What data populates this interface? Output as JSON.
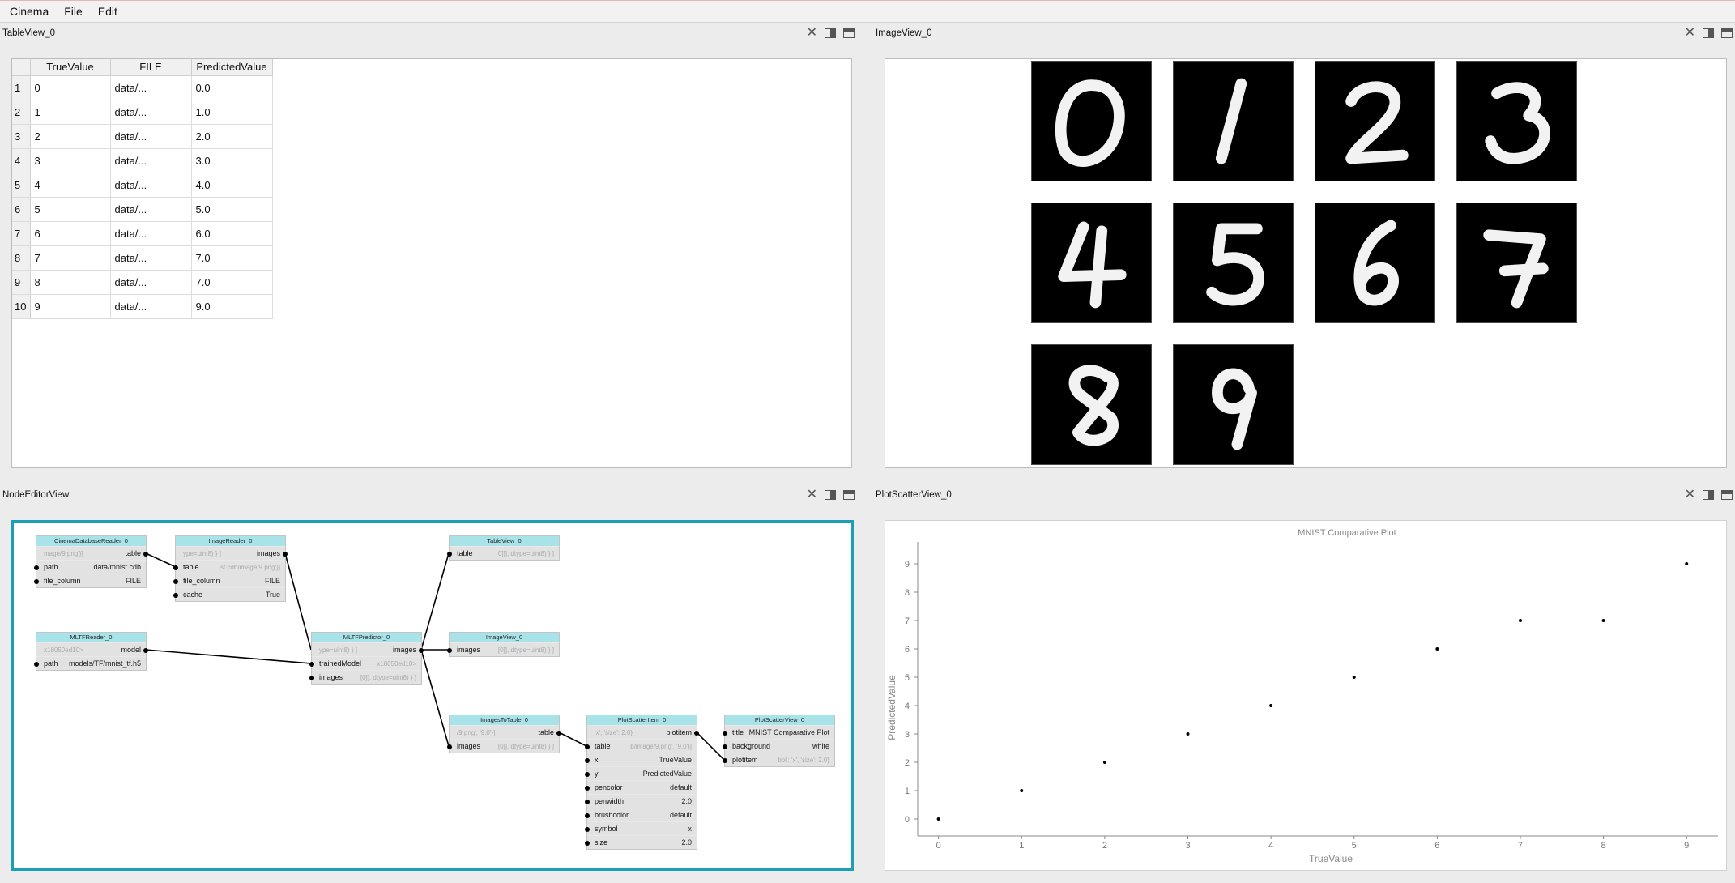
{
  "menubar": {
    "items": [
      "Cinema",
      "File",
      "Edit"
    ]
  },
  "table_view": {
    "title": "TableView_0",
    "columns": [
      "TrueValue",
      "FILE",
      "PredictedValue"
    ],
    "rows": [
      {
        "n": "1",
        "true": "0",
        "file": "data/...",
        "pred": "0.0"
      },
      {
        "n": "2",
        "true": "1",
        "file": "data/...",
        "pred": "1.0"
      },
      {
        "n": "3",
        "true": "2",
        "file": "data/...",
        "pred": "2.0"
      },
      {
        "n": "4",
        "true": "3",
        "file": "data/...",
        "pred": "3.0"
      },
      {
        "n": "5",
        "true": "4",
        "file": "data/...",
        "pred": "4.0"
      },
      {
        "n": "6",
        "true": "5",
        "file": "data/...",
        "pred": "5.0"
      },
      {
        "n": "7",
        "true": "6",
        "file": "data/...",
        "pred": "6.0"
      },
      {
        "n": "8",
        "true": "7",
        "file": "data/...",
        "pred": "7.0"
      },
      {
        "n": "9",
        "true": "8",
        "file": "data/...",
        "pred": "7.0"
      },
      {
        "n": "10",
        "true": "9",
        "file": "data/...",
        "pred": "9.0"
      }
    ]
  },
  "image_view": {
    "title": "ImageView_0",
    "digits": [
      "0",
      "1",
      "2",
      "3",
      "4",
      "5",
      "6",
      "7",
      "8",
      "9"
    ]
  },
  "node_editor": {
    "title": "NodeEditorView",
    "accent": "#1a9fb5",
    "nodes": {
      "cdr": {
        "title": "CinemaDatabaseReader_0",
        "out_preview": "mage/9.png'}]",
        "out_label": "table",
        "rows": [
          [
            "path",
            "data/mnist.cdb"
          ],
          [
            "file_column",
            "FILE"
          ]
        ]
      },
      "ir": {
        "title": "ImageReader_0",
        "out_preview": "ype=uint8) } ]",
        "out_label": "images",
        "rows": [
          [
            "table",
            "st.cdb/image/9.png'}]"
          ],
          [
            "file_column",
            "FILE"
          ],
          [
            "cache",
            "True"
          ]
        ]
      },
      "mltfr": {
        "title": "MLTFReader_0",
        "out_preview": "x18050ed10>",
        "out_label": "model",
        "rows": [
          [
            "path",
            "models/TF/mnist_tf.h5"
          ]
        ]
      },
      "mltfp": {
        "title": "MLTFPredictor_0",
        "out_preview": "ype=uint8) } ]",
        "out_label": "images",
        "rows": [
          [
            "trainedModel",
            "x18050ed10>"
          ],
          [
            "images",
            "[0]], dtype=uint8) } ]"
          ]
        ]
      },
      "tv": {
        "title": "TableView_0",
        "rows": [
          [
            "table",
            "0]]], dtype=uint8) } ]"
          ]
        ]
      },
      "iv": {
        "title": "ImageView_0",
        "rows": [
          [
            "images",
            "[0]], dtype=uint8) } ]"
          ]
        ]
      },
      "itt": {
        "title": "ImagesToTable_0",
        "out_preview": "/9.png', '9.0'}]",
        "out_label": "table",
        "rows": [
          [
            "images",
            "[0]], dtype=uint8) } ]"
          ]
        ]
      },
      "psi": {
        "title": "PlotScatterItem_0",
        "out_preview": "'x', 'size': 2.0}",
        "out_label": "plotitem",
        "rows": [
          [
            "table",
            "b/image/9.png', '9.0'}]"
          ],
          [
            "x",
            "TrueValue"
          ],
          [
            "y",
            "PredictedValue"
          ],
          [
            "pencolor",
            "default"
          ],
          [
            "penwidth",
            "2.0"
          ],
          [
            "brushcolor",
            "default"
          ],
          [
            "symbol",
            "x"
          ],
          [
            "size",
            "2.0"
          ]
        ]
      },
      "psv": {
        "title": "PlotScatterView_0",
        "rows": [
          [
            "title",
            "MNIST Comparative Plot"
          ],
          [
            "background",
            "white"
          ],
          [
            "plotitem",
            "bol': 'x', 'size': 2.0}"
          ]
        ]
      }
    }
  },
  "plot_view": {
    "title": "PlotScatterView_0"
  },
  "chart_data": {
    "type": "scatter",
    "title": "MNIST Comparative Plot",
    "xlabel": "TrueValue",
    "ylabel": "PredictedValue",
    "x_ticks": [
      "0",
      "1",
      "2",
      "3",
      "4",
      "5",
      "6",
      "7",
      "8",
      "9"
    ],
    "y_ticks": [
      "0",
      "1",
      "2",
      "3",
      "4",
      "5",
      "6",
      "7",
      "8",
      "9"
    ],
    "xlim": [
      -0.25,
      9.3
    ],
    "ylim": [
      -0.6,
      9.6
    ],
    "series": [
      {
        "x": [
          0,
          1,
          2,
          3,
          4,
          5,
          6,
          7,
          8,
          9
        ],
        "y": [
          0.0,
          1.0,
          2.0,
          3.0,
          4.0,
          5.0,
          6.0,
          7.0,
          7.0,
          9.0
        ]
      }
    ],
    "background": "white"
  }
}
